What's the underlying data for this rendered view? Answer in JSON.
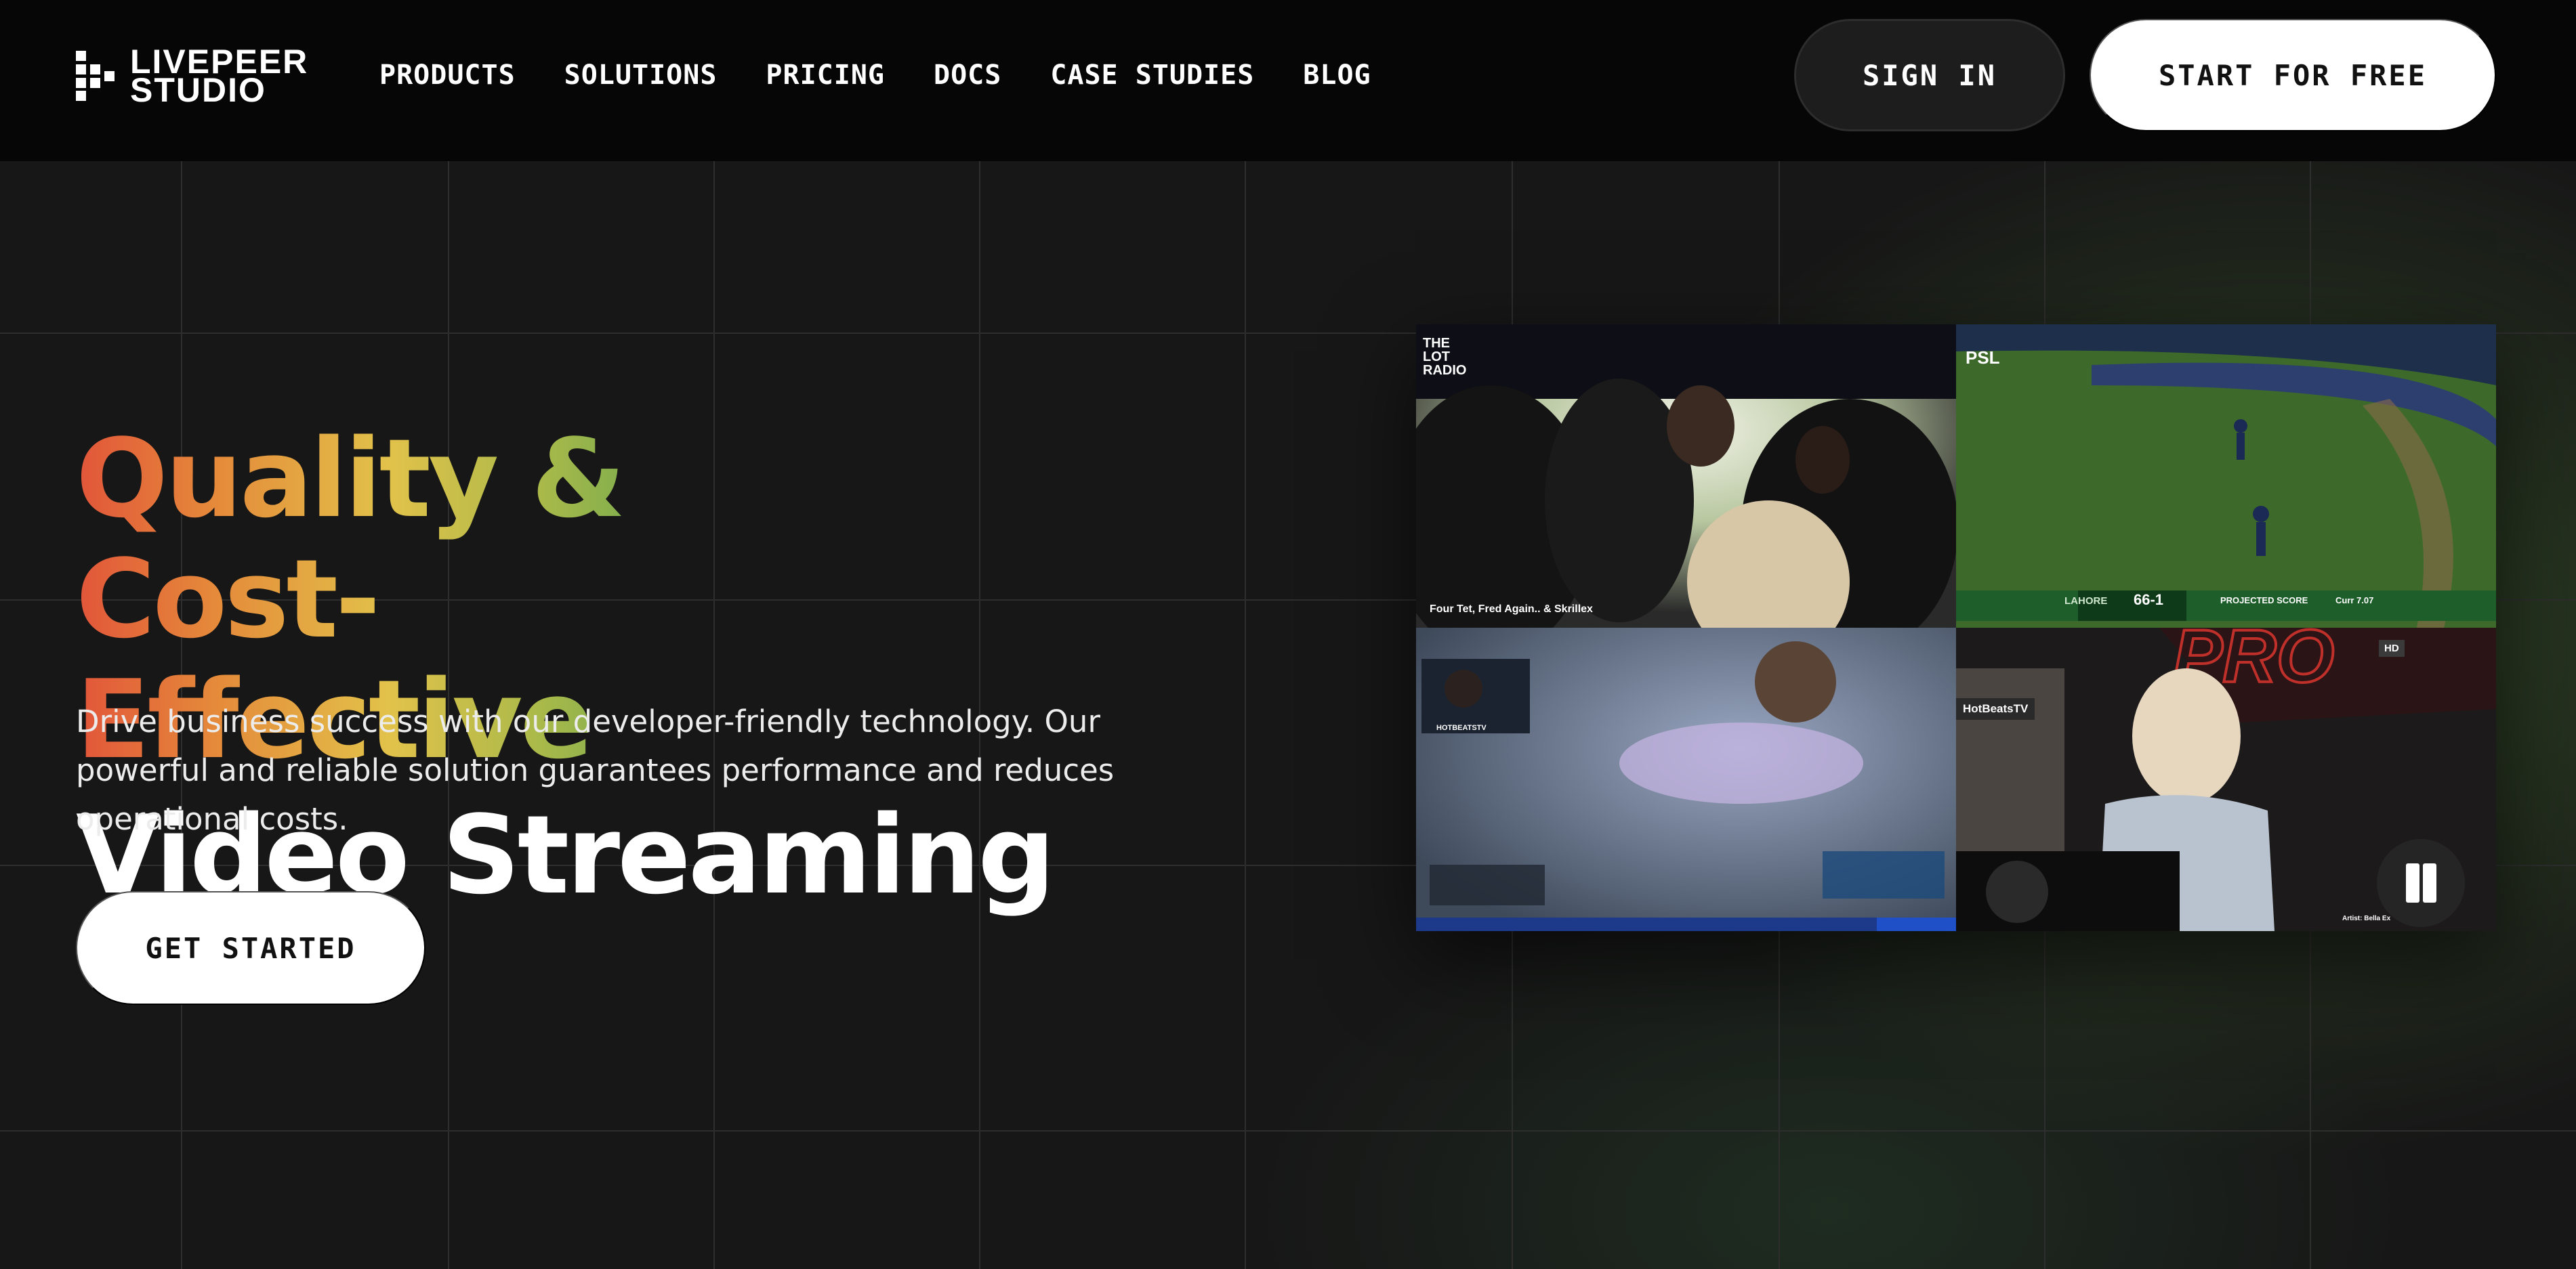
{
  "brand": {
    "logo_line1": "LIVEPEER",
    "logo_line2": "STUDIO"
  },
  "nav": {
    "links": [
      "PRODUCTS",
      "SOLUTIONS",
      "PRICING",
      "DOCS",
      "CASE STUDIES",
      "BLOG"
    ],
    "sign_in_label": "SIGN IN",
    "start_label": "START FOR FREE"
  },
  "hero": {
    "headline_line1": "Quality & Cost-",
    "headline_line2": "Effective",
    "headline_line3": "Video Streaming",
    "subtext": "Drive business success with our developer-friendly technology. Our powerful and reliable solution guarantees performance and reduces operational costs.",
    "cta_label": "GET STARTED"
  },
  "videos": {
    "tile1_badge": "THE LOT RADIO",
    "tile1_caption": "Four Tet, Fred Again.. & Skrillex",
    "tile2_badge": "PSL",
    "tile2_team": "LAHORE",
    "tile2_score": "66-1",
    "tile2_projected": "PROJECTED SCORE",
    "tile2_rate": "Curr 7.07",
    "tile3_channel": "HOTBEATSTV",
    "tile4_tag": "HotBeatsTV",
    "tile4_caption": "Artist: Bella Ex",
    "tile4_hd": "HD"
  },
  "colors": {
    "accent_gradient": [
      "#e2553a",
      "#e2c24a",
      "#4f9a55"
    ],
    "cta_background": "#ffffff",
    "nav_background": "#060606"
  },
  "icons": {
    "pause": "pause-icon",
    "logo": "livepeer-logo-icon"
  }
}
